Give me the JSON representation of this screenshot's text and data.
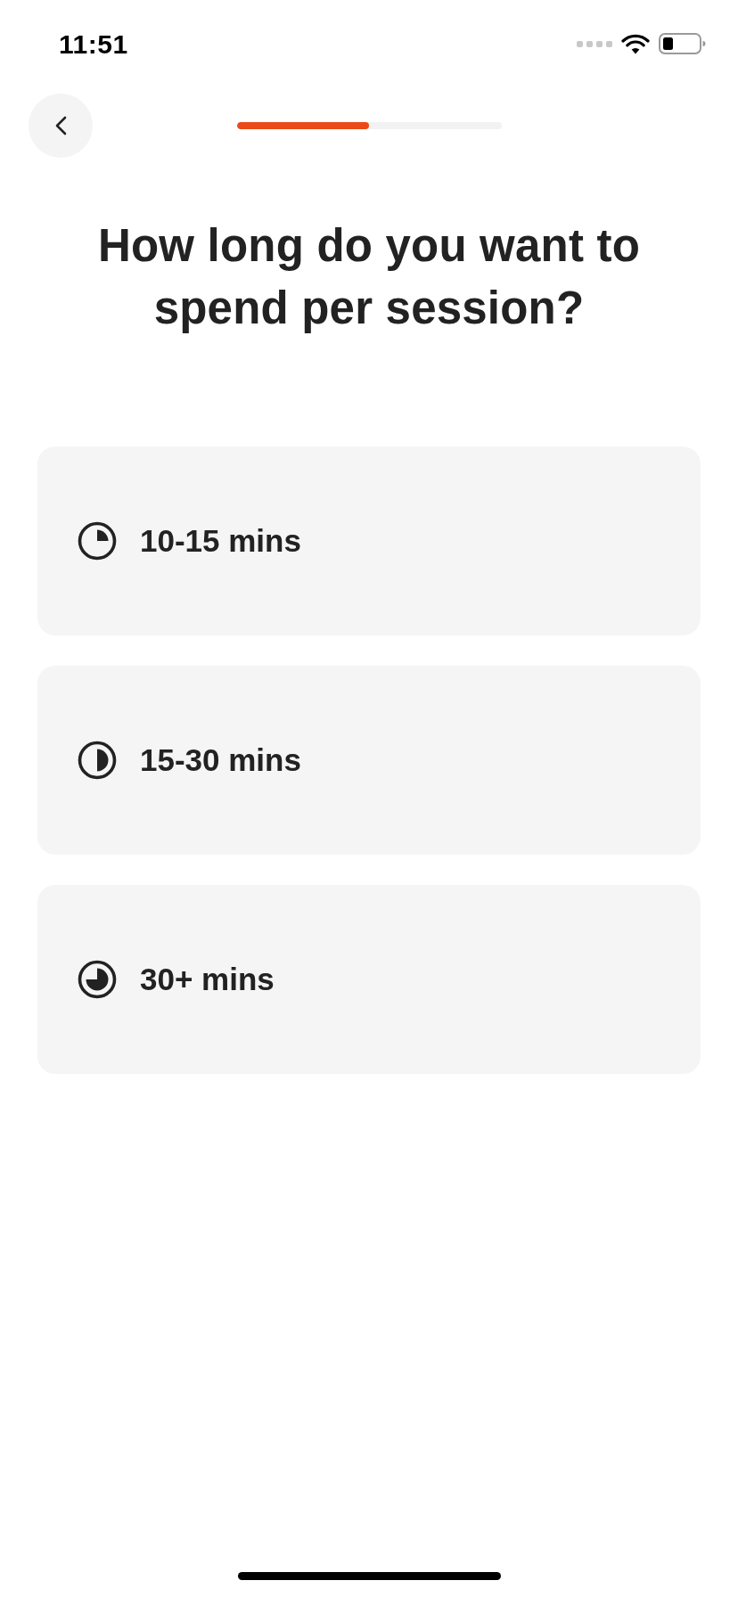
{
  "status_bar": {
    "time": "11:51"
  },
  "progress": {
    "level": 0.5
  },
  "title": "How long do you want to spend per session?",
  "options": [
    {
      "label": "10-15 mins",
      "selected": false
    },
    {
      "label": "15-30 mins",
      "selected": false
    },
    {
      "label": "30+ mins",
      "selected": false
    }
  ]
}
